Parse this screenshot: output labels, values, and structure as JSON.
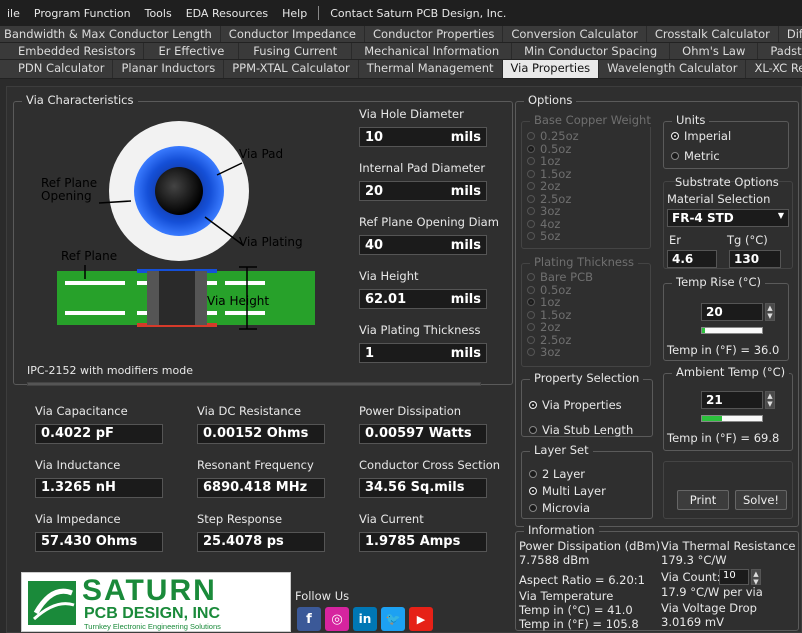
{
  "menubar": {
    "items": [
      "ile",
      "Program Function",
      "Tools",
      "EDA Resources",
      "Help",
      "Contact Saturn PCB Design, Inc."
    ]
  },
  "tabs": {
    "row1": [
      "Bandwidth & Max Conductor Length",
      "Conductor Impedance",
      "Conductor Properties",
      "Conversion Calculator",
      "Crosstalk Calculator",
      "Differential Pair"
    ],
    "row2": [
      "Embedded Resistors",
      "Er Effective",
      "Fusing Current",
      "Mechanical Information",
      "Min Conductor Spacing",
      "Ohm's Law",
      "Padstack Calculator"
    ],
    "row3": [
      "PDN Calculator",
      "Planar Inductors",
      "PPM-XTAL Calculator",
      "Thermal Management",
      "Via Properties",
      "Wavelength Calculator",
      "XL-XC Reactance"
    ],
    "active": "Via Properties"
  },
  "via_characteristics": {
    "title": "Via Characteristics",
    "diagram": {
      "via_pad": "Via Pad",
      "ref_plane_opening": "Ref Plane\nOpening",
      "via_plating": "Via Plating",
      "ref_plane": "Ref Plane",
      "via_height": "Via Height"
    },
    "inputs": [
      {
        "label": "Via Hole Diameter",
        "value": "10",
        "unit": "mils"
      },
      {
        "label": "Internal Pad Diameter",
        "value": "20",
        "unit": "mils"
      },
      {
        "label": "Ref Plane Opening Diam",
        "value": "40",
        "unit": "mils"
      },
      {
        "label": "Via Height",
        "value": "62.01",
        "unit": "mils"
      },
      {
        "label": "Via Plating Thickness",
        "value": "1",
        "unit": "mils"
      }
    ],
    "mode_text": "IPC-2152 with modifiers mode"
  },
  "results": [
    {
      "label": "Via Capacitance",
      "value": "0.4022 pF"
    },
    {
      "label": "Via DC Resistance",
      "value": "0.00152 Ohms"
    },
    {
      "label": "Power Dissipation",
      "value": "0.00597 Watts"
    },
    {
      "label": "Via Inductance",
      "value": "1.3265 nH"
    },
    {
      "label": "Resonant Frequency",
      "value": "6890.418 MHz"
    },
    {
      "label": "Conductor Cross Section",
      "value": "34.56 Sq.mils"
    },
    {
      "label": "Via Impedance",
      "value": "57.430 Ohms"
    },
    {
      "label": "Step Response",
      "value": "25.4078 ps"
    },
    {
      "label": "Via Current",
      "value": "1.9785 Amps"
    }
  ],
  "logo": {
    "line1": "SATURN",
    "line2": "PCB DESIGN, INC",
    "line3": "Turnkey Electronic Engineering Solutions"
  },
  "follow_us": "Follow Us",
  "social_icons": [
    "f",
    "◎",
    "in",
    "🐦",
    "▶"
  ],
  "options": {
    "title": "Options",
    "base_copper_weight": {
      "title": "Base Copper Weight",
      "options": [
        "0.25oz",
        "0.5oz",
        "1oz",
        "1.5oz",
        "2oz",
        "2.5oz",
        "3oz",
        "4oz",
        "5oz"
      ],
      "selected": "0.5oz"
    },
    "plating_thickness": {
      "title": "Plating Thickness",
      "options": [
        "Bare PCB",
        "0.5oz",
        "1oz",
        "1.5oz",
        "2oz",
        "2.5oz",
        "3oz"
      ],
      "selected": "1oz"
    },
    "units": {
      "title": "Units",
      "options": [
        "Imperial",
        "Metric"
      ],
      "selected": "Imperial"
    },
    "substrate": {
      "title": "Substrate Options",
      "material_label": "Material Selection",
      "material_value": "FR-4 STD",
      "er_label": "Er",
      "er_value": "4.6",
      "tg_label": "Tg (°C)",
      "tg_value": "130"
    },
    "temp_rise": {
      "title": "Temp Rise (°C)",
      "value": "20",
      "progress": 0.05,
      "f_label": "Temp in (°F) = 36.0"
    },
    "property_selection": {
      "title": "Property Selection",
      "options": [
        "Via Properties",
        "Via Stub Length"
      ],
      "selected": "Via Properties"
    },
    "ambient_temp": {
      "title": "Ambient Temp (°C)",
      "value": "21",
      "progress": 0.33,
      "f_label": "Temp in (°F) = 69.8"
    },
    "layer_set": {
      "title": "Layer Set",
      "options": [
        "2 Layer",
        "Multi Layer",
        "Microvia"
      ],
      "selected": "Multi Layer"
    },
    "print_label": "Print",
    "solve_label": "Solve!"
  },
  "information": {
    "title": "Information",
    "power_dissipation_label": "Power Dissipation (dBm)",
    "power_dissipation_value": "7.7588 dBm",
    "aspect_ratio": "Aspect Ratio = 6.20:1",
    "via_temperature_label": "Via Temperature",
    "temp_c": "Temp in (°C) = 41.0",
    "temp_f": "Temp in (°F) = 105.8",
    "thermal_resistance_label": "Via Thermal Resistance",
    "thermal_resistance_value": "179.3 °C/W",
    "via_count_label": "Via Count:",
    "via_count_value": "10",
    "per_via": "17.9 °C/W per via",
    "voltage_drop_label": "Via Voltage Drop",
    "voltage_drop_value": "3.0169 mV"
  },
  "colors": {
    "accent_green": "#2cc13d",
    "via_blue": "#1550d8",
    "board_green": "#27a12a"
  }
}
